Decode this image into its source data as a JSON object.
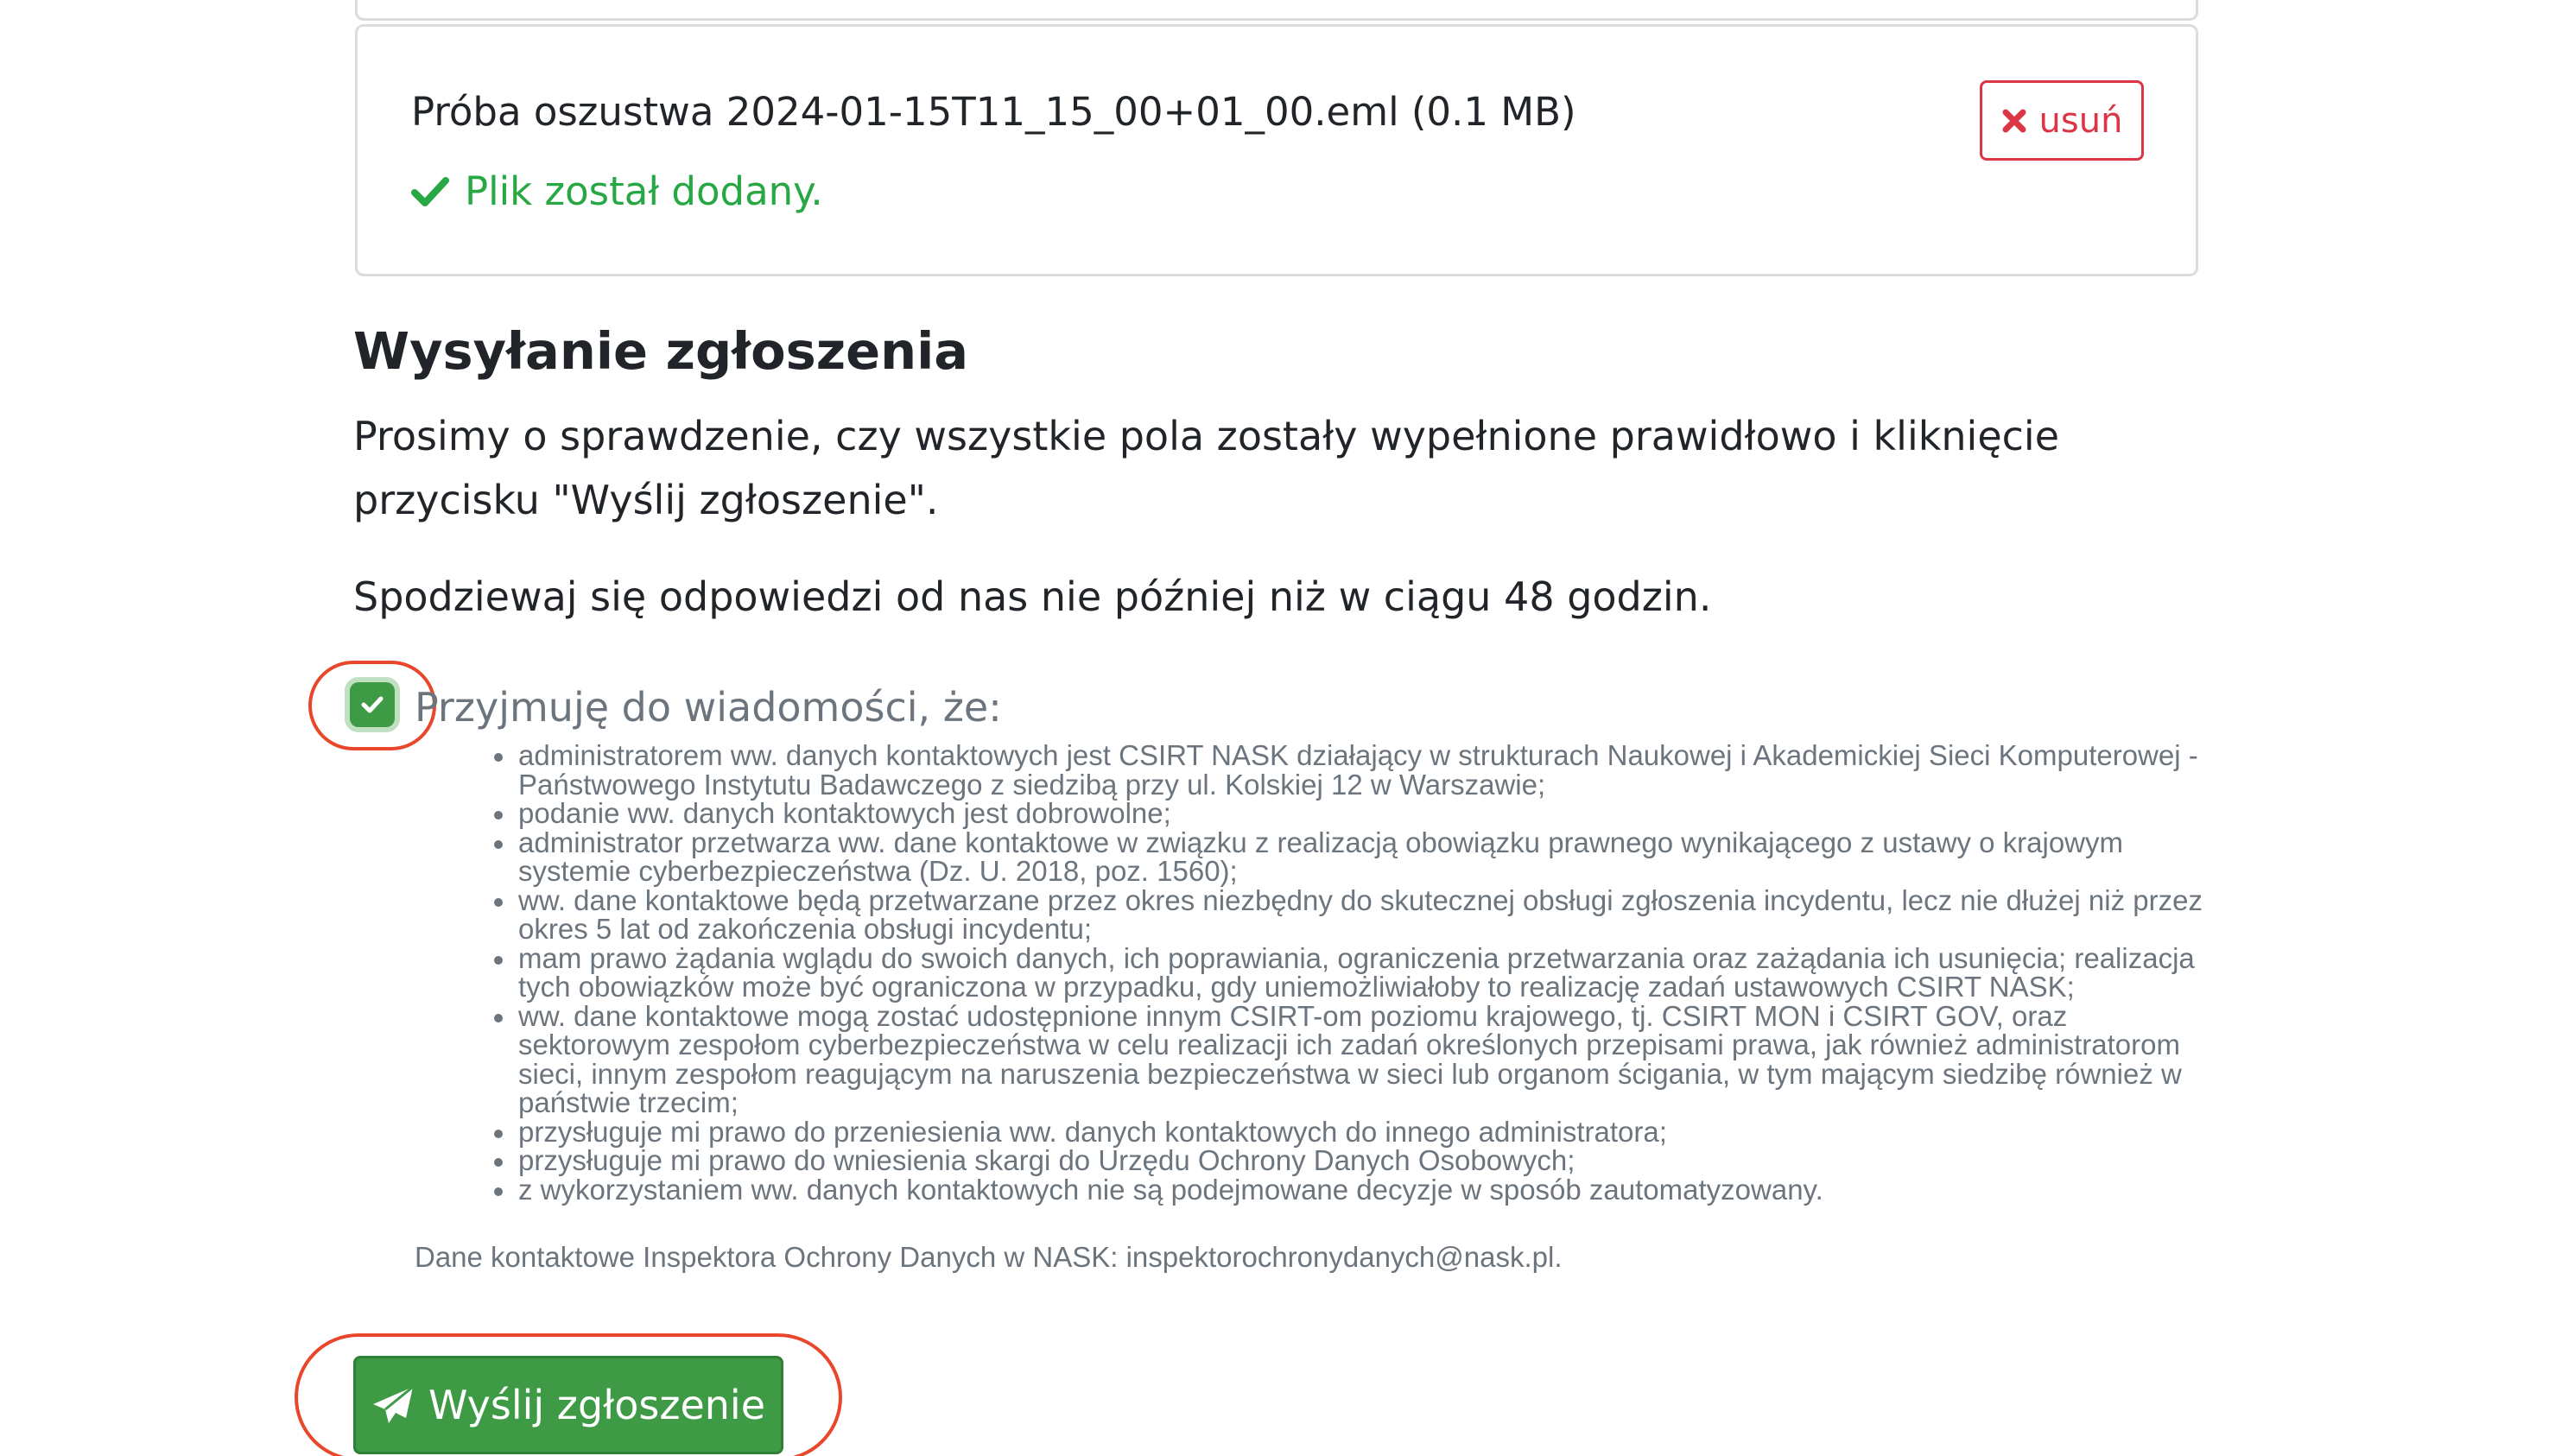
{
  "file": {
    "name": "Próba oszustwa 2024-01-15T11_15_00+01_00.eml (0.1 MB)",
    "status": "Plik został dodany.",
    "remove_label": "usuń"
  },
  "submission": {
    "title": "Wysyłanie zgłoszenia",
    "instructions": "Prosimy o sprawdzenie, czy wszystkie pola zostały wypełnione prawidłowo i kliknięcie przycisku \"Wyślij zgłoszenie\".",
    "response_time": "Spodziewaj się odpowiedzi od nas nie później niż w ciągu 48 godzin."
  },
  "consent": {
    "checked": true,
    "label": "Przyjmuję do wiadomości, że:",
    "items": [
      "administratorem ww. danych kontaktowych jest CSIRT NASK działający w strukturach Naukowej i Akademickiej Sieci Komputerowej - Państwowego Instytutu Badawczego z siedzibą przy ul. Kolskiej 12 w Warszawie;",
      "podanie ww. danych kontaktowych jest dobrowolne;",
      "administrator przetwarza ww. dane kontaktowe w związku z realizacją obowiązku prawnego wynikającego z ustawy o krajowym systemie cyberbezpieczeństwa (Dz. U. 2018, poz. 1560);",
      "ww. dane kontaktowe będą przetwarzane przez okres niezbędny do skutecznej obsługi zgłoszenia incydentu, lecz nie dłużej niż przez okres 5 lat od zakończenia obsługi incydentu;",
      "mam prawo żądania wglądu do swoich danych, ich poprawiania, ograniczenia przetwarzania oraz zażądania ich usunięcia; realizacja tych obowiązków może być ograniczona w przypadku, gdy uniemożliwiałoby to realizację zadań ustawowych CSIRT NASK;",
      "ww. dane kontaktowe mogą zostać udostępnione innym CSIRT-om poziomu krajowego, tj. CSIRT MON i CSIRT GOV, oraz sektorowym zespołom cyberbezpieczeństwa w celu realizacji ich zadań określonych przepisami prawa, jak również administratorom sieci, innym zespołom reagującym na naruszenia bezpieczeństwa w sieci lub organom ścigania, w tym mającym siedzibę również w państwie trzecim;",
      "przysługuje mi prawo do przeniesienia ww. danych kontaktowych do innego administratora;",
      "przysługuje mi prawo do wniesienia skargi do Urzędu Ochrony Danych Osobowych;",
      "z wykorzystaniem ww. danych kontaktowych nie są podejmowane decyzje w sposób zautomatyzowany."
    ],
    "dpo_contact": "Dane kontaktowe Inspektora Ochrony Danych w NASK: inspektorochronydanych@nask.pl."
  },
  "submit": {
    "label": "Wyślij zgłoszenie"
  },
  "colors": {
    "success": "#28a745",
    "danger": "#dc3545",
    "button_green": "#3f9a46",
    "highlight_ring": "#e8472b",
    "muted_text": "#6c757d"
  },
  "icons": {
    "status": "check-icon",
    "remove": "times-icon",
    "consent": "checkbox-check-icon",
    "submit": "paper-plane-icon"
  }
}
